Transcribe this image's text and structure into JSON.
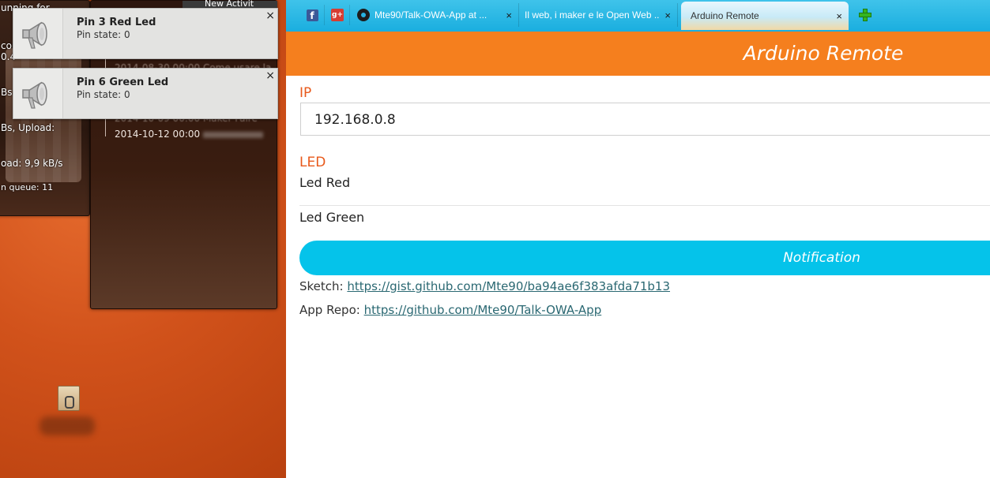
{
  "desktop": {
    "widget_a_lines": [
      "unning for",
      "con",
      "0.4",
      "Bs",
      "Bs, Upload:",
      "oad: 9,9 kB/s",
      "n queue: 11"
    ],
    "widget_b_tab_text": "New Activit",
    "tree_rows": [
      {
        "text": "2014-08-30 00:00 Come usare la"
      },
      {
        "text": "2014-10-09 00:00 Maker Faire"
      },
      {
        "text": "2014-10-12 00:00"
      }
    ]
  },
  "notifications": [
    {
      "title": "Pin 3 Red Led",
      "body": "Pin state: 0",
      "close": "×"
    },
    {
      "title": "Pin 6 Green Led",
      "body": "Pin state: 0",
      "close": "×"
    }
  ],
  "browser": {
    "tabs": [
      {
        "label": "Mte90/Talk-OWA-App at ...",
        "close": "×"
      },
      {
        "label": "Il web, i maker e le Open Web ...",
        "close": "×"
      },
      {
        "label": "Arduino Remote",
        "close": "×",
        "active": true
      }
    ],
    "pinned_icons": [
      "facebook-icon",
      "google-plus-icon"
    ]
  },
  "app": {
    "title": "Arduino Remote",
    "ip_label": "IP",
    "ip_value": "192.168.0.8",
    "led_label": "LED",
    "leds": [
      "Led Red",
      "Led Green"
    ],
    "notification_button": "Notification",
    "sketch_label": "Sketch:",
    "sketch_url": "https://gist.github.com/Mte90/ba94ae6f383afda71b13",
    "repo_label": "App Repo:",
    "repo_url": "https://github.com/Mte90/Talk-OWA-App"
  },
  "colors": {
    "header_orange": "#f57f1e",
    "accent_orange_text": "#e8591b",
    "button_cyan": "#05c3ea",
    "tabbar_blue": "#1aaedf"
  }
}
